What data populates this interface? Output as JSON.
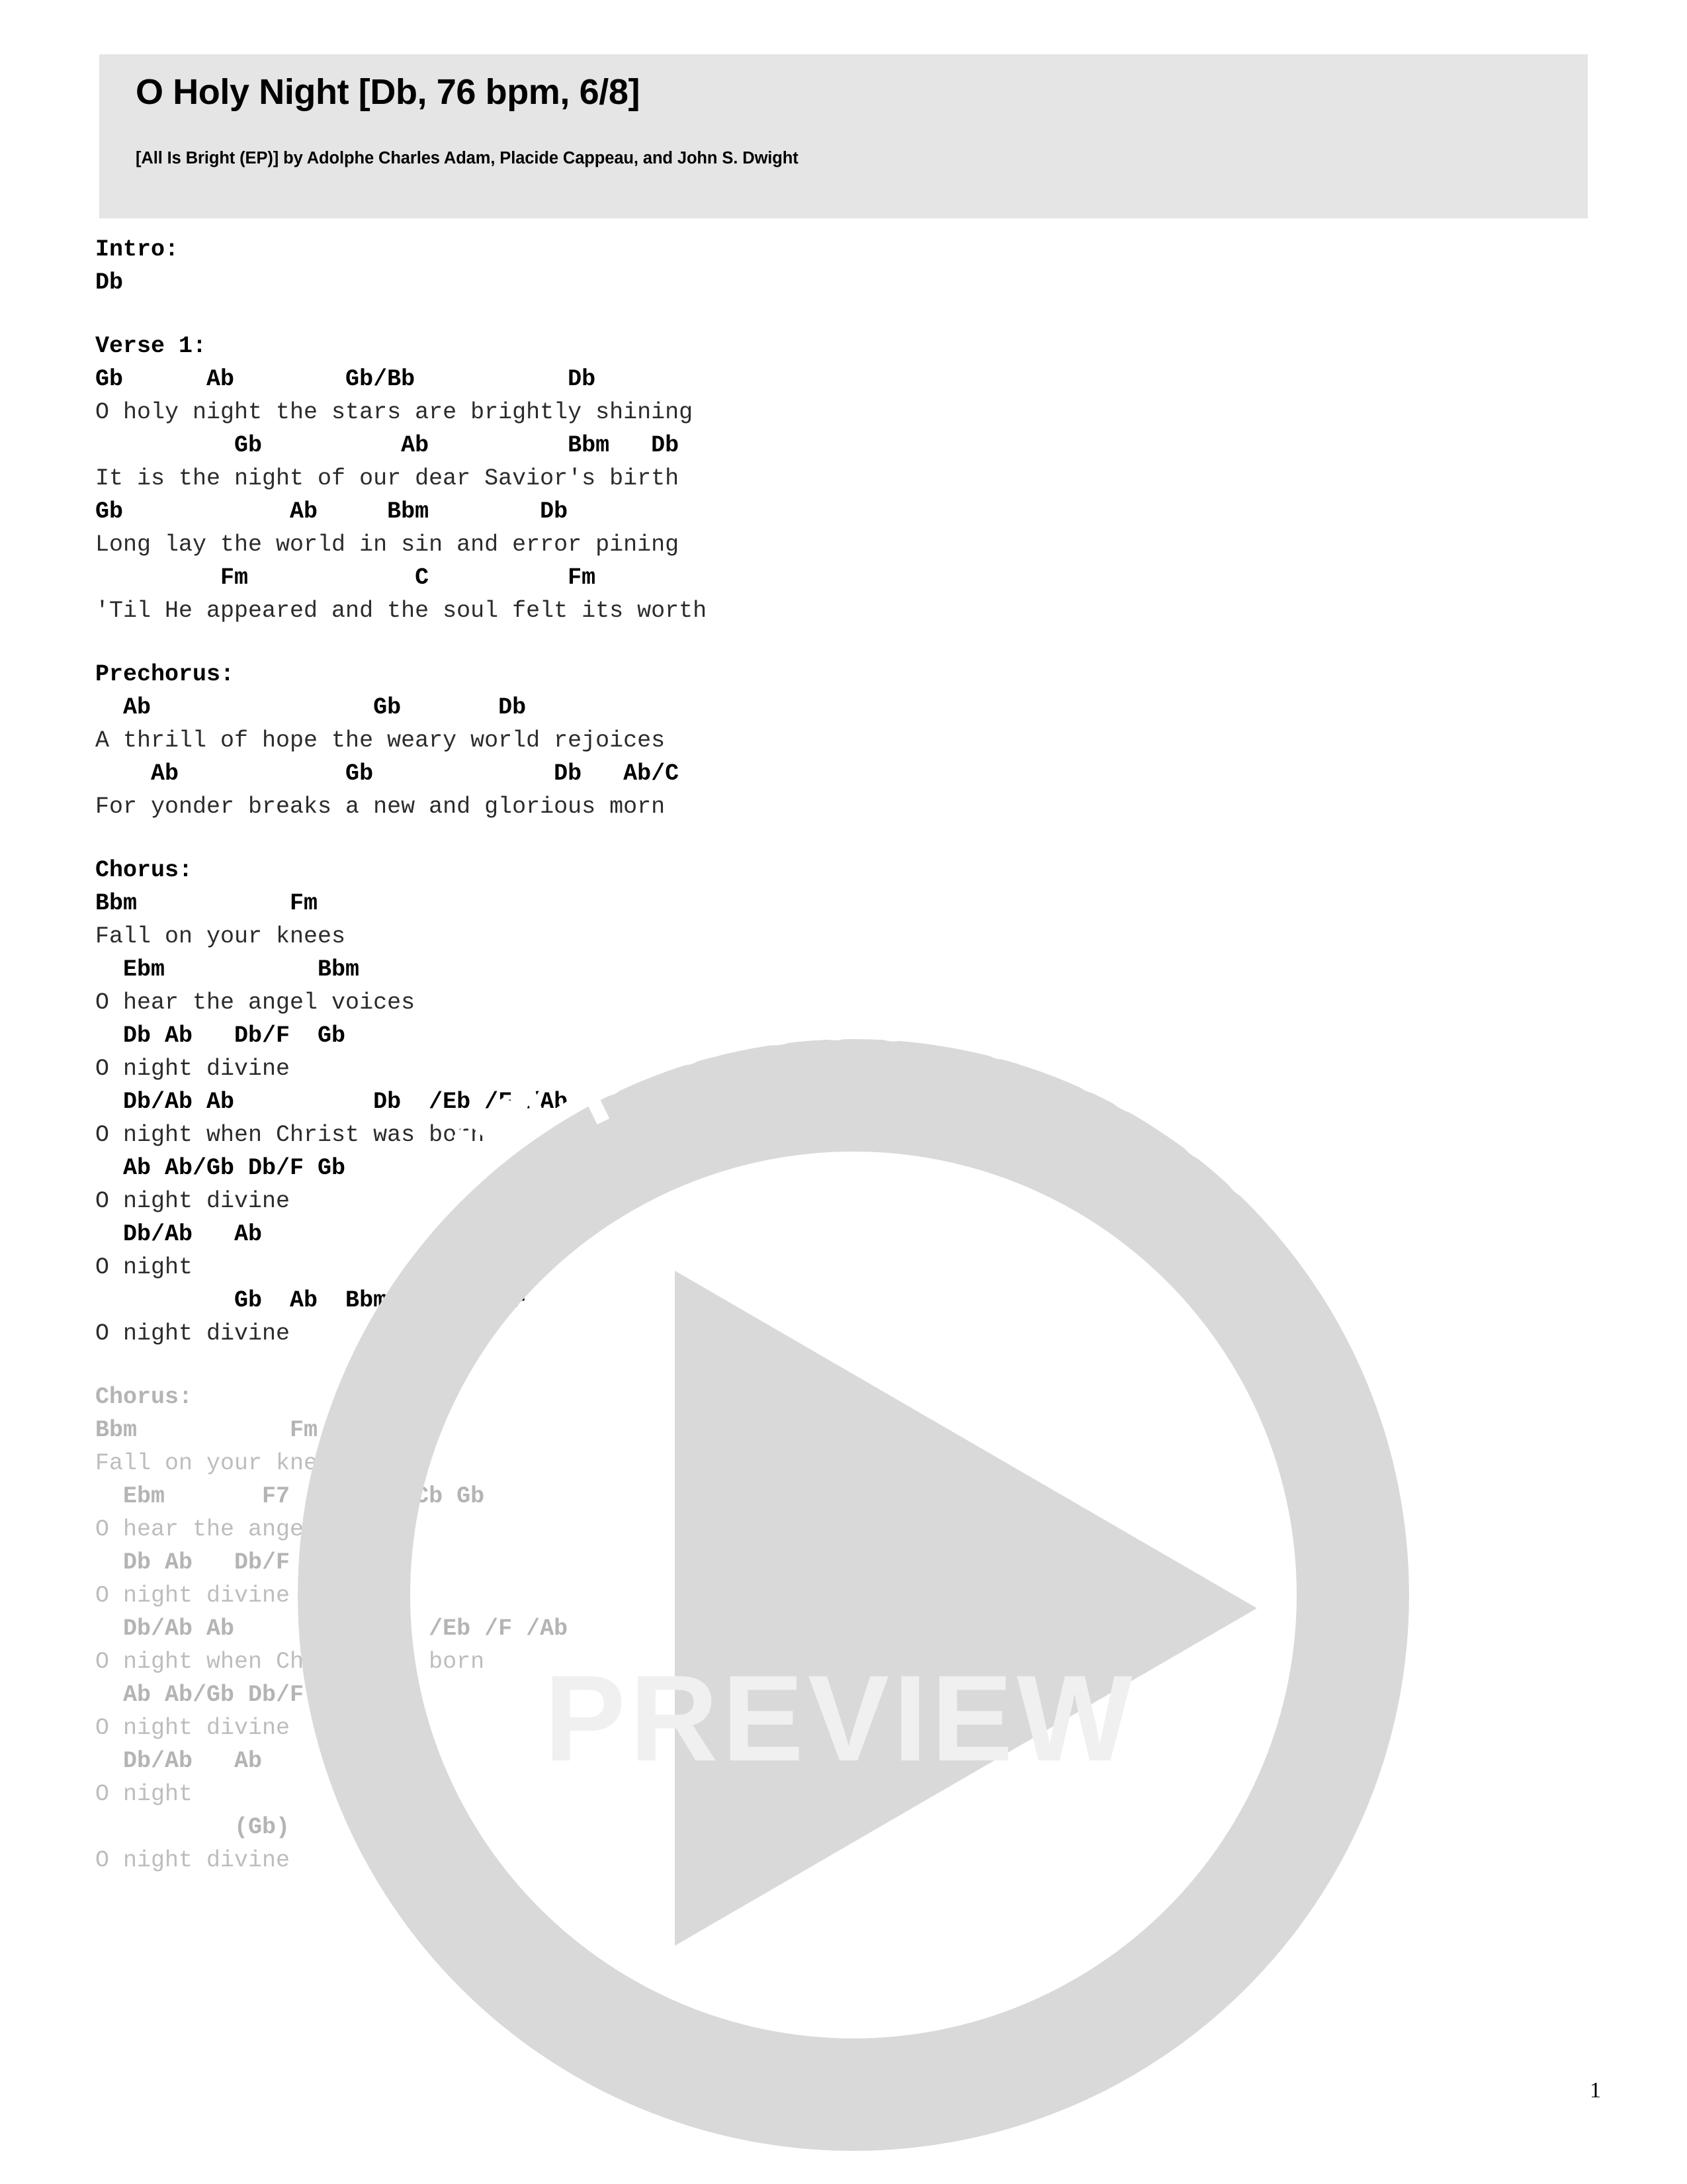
{
  "header": {
    "title": "O Holy Night [Db, 76 bpm, 6/8]",
    "subtitle": "[All Is Bright (EP)] by Adolphe Charles Adam, Placide Cappeau, and John S. Dwight",
    "band_color": "#e5e5e5"
  },
  "watermark": {
    "arc_text": "www.praisecharts.com",
    "preview_text": "PREVIEW",
    "play_icon": "play-triangle-icon",
    "color": "#d9d9d9"
  },
  "page_number": "1",
  "sections": [
    {
      "name": "intro",
      "label": "Intro:",
      "faded": false,
      "lines": [
        {
          "type": "chords",
          "text": "Db"
        }
      ]
    },
    {
      "name": "verse-1",
      "label": "Verse 1:",
      "faded": false,
      "lines": [
        {
          "type": "chords",
          "text": "Gb      Ab        Gb/Bb           Db"
        },
        {
          "type": "lyrics",
          "text": "O holy night the stars are brightly shining"
        },
        {
          "type": "chords",
          "text": "          Gb          Ab          Bbm   Db"
        },
        {
          "type": "lyrics",
          "text": "It is the night of our dear Savior's birth"
        },
        {
          "type": "chords",
          "text": "Gb            Ab     Bbm        Db"
        },
        {
          "type": "lyrics",
          "text": "Long lay the world in sin and error pining"
        },
        {
          "type": "chords",
          "text": "         Fm            C          Fm"
        },
        {
          "type": "lyrics",
          "text": "'Til He appeared and the soul felt its worth"
        }
      ]
    },
    {
      "name": "prechorus",
      "label": "Prechorus:",
      "faded": false,
      "lines": [
        {
          "type": "chords",
          "text": "  Ab                Gb       Db"
        },
        {
          "type": "lyrics",
          "text": "A thrill of hope the weary world rejoices"
        },
        {
          "type": "chords",
          "text": "    Ab            Gb             Db   Ab/C"
        },
        {
          "type": "lyrics",
          "text": "For yonder breaks a new and glorious morn"
        }
      ]
    },
    {
      "name": "chorus-1",
      "label": "Chorus:",
      "faded": false,
      "lines": [
        {
          "type": "chords",
          "text": "Bbm           Fm"
        },
        {
          "type": "lyrics",
          "text": "Fall on your knees"
        },
        {
          "type": "chords",
          "text": "  Ebm           Bbm"
        },
        {
          "type": "lyrics",
          "text": "O hear the angel voices"
        },
        {
          "type": "chords",
          "text": "  Db Ab   Db/F  Gb"
        },
        {
          "type": "lyrics",
          "text": "O night divine"
        },
        {
          "type": "chords",
          "text": "  Db/Ab Ab          Db  /Eb /F /Ab"
        },
        {
          "type": "lyrics",
          "text": "O night when Christ was born"
        },
        {
          "type": "chords",
          "text": "  Ab Ab/Gb Db/F Gb"
        },
        {
          "type": "lyrics",
          "text": "O night divine"
        },
        {
          "type": "chords",
          "text": "  Db/Ab   Ab"
        },
        {
          "type": "lyrics",
          "text": "O night"
        },
        {
          "type": "chords",
          "text": "          Gb  Ab  Bbm  Fsus4  F"
        },
        {
          "type": "lyrics",
          "text": "O night divine"
        }
      ]
    },
    {
      "name": "chorus-2",
      "label": "Chorus:",
      "faded": true,
      "lines": [
        {
          "type": "chords",
          "text": "Bbm           Fm"
        },
        {
          "type": "lyrics",
          "text": "Fall on your knees"
        },
        {
          "type": "chords",
          "text": "  Ebm       F7    Bbm  Cb Gb"
        },
        {
          "type": "lyrics",
          "text": "O hear the angel voices"
        },
        {
          "type": "chords",
          "text": "  Db Ab   Db/F  Gb"
        },
        {
          "type": "lyrics",
          "text": "O night divine"
        },
        {
          "type": "chords",
          "text": "  Db/Ab Ab          Db  /Eb /F /Ab"
        },
        {
          "type": "lyrics",
          "text": "O night when Christ was born"
        },
        {
          "type": "chords",
          "text": "  Ab Ab/Gb Db/F Gb"
        },
        {
          "type": "lyrics",
          "text": "O night divine"
        },
        {
          "type": "chords",
          "text": "  Db/Ab   Ab"
        },
        {
          "type": "lyrics",
          "text": "O night"
        },
        {
          "type": "chords",
          "text": "          (Gb)"
        },
        {
          "type": "lyrics",
          "text": "O night divine"
        }
      ]
    }
  ]
}
